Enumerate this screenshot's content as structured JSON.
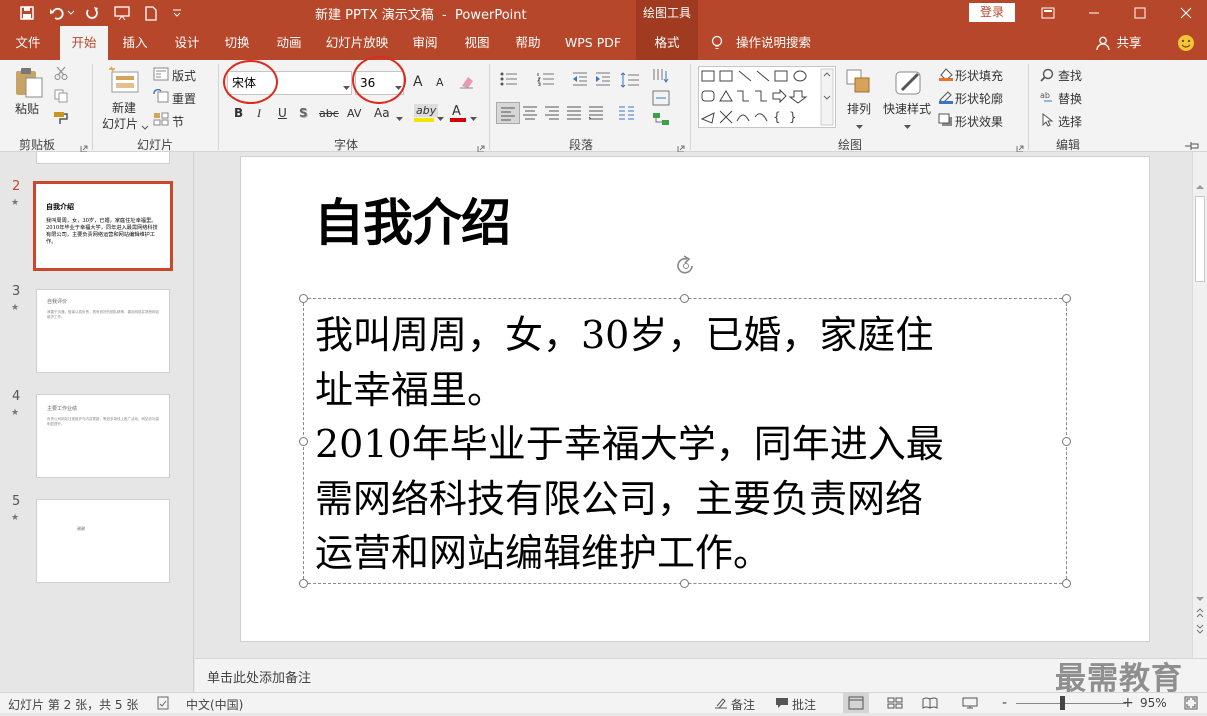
{
  "app": {
    "window_title": "新建 PPTX 演示文稿  -  PowerPoint",
    "context_tools": "绘图工具",
    "login": "登录"
  },
  "tabs": [
    "文件",
    "开始",
    "插入",
    "设计",
    "切换",
    "动画",
    "幻灯片放映",
    "审阅",
    "视图",
    "帮助",
    "WPS PDF",
    "格式"
  ],
  "tell_me": "操作说明搜索",
  "share": "共享",
  "ribbon": {
    "clipboard": {
      "paste": "粘贴",
      "label": "剪贴板"
    },
    "slides": {
      "new_slide_1": "新建",
      "new_slide_2": "幻灯片",
      "layout": "版式",
      "reset": "重置",
      "section": "节",
      "label": "幻灯片"
    },
    "font": {
      "name": "宋体",
      "size": "36",
      "grow": "A",
      "shrink": "A",
      "bold": "B",
      "italic": "I",
      "underline": "U",
      "shadow": "S",
      "strike": "abc",
      "spacing": "AV",
      "case": "Aa",
      "highlight": "aby",
      "color": "A",
      "label": "字体"
    },
    "paragraph": {
      "label": "段落"
    },
    "drawing": {
      "arrange": "排列",
      "quick_styles": "快速样式",
      "fill": "形状填充",
      "outline": "形状轮廓",
      "effects": "形状效果",
      "label": "绘图"
    },
    "editing": {
      "find": "查找",
      "replace": "替换",
      "select": "选择",
      "label": "编辑"
    }
  },
  "thumbnails": [
    {
      "num": "2",
      "star": "★",
      "title": "自我介绍",
      "body": "我叫周周，女，30岁，已婚，家庭住址幸福里。2010年毕业于幸福大学，同年进入最需网络科技有限公司，主要负责网络运营和网站编辑维护工作。"
    },
    {
      "num": "3",
      "star": "★",
      "title": "自我评价",
      "body": "我善于沟通，做事认真负责，具有良好的团队精神，喜欢网络并熟悉网站维护工作。"
    },
    {
      "num": "4",
      "star": "★",
      "title": "主要工作业绩",
      "body": "负责公司网站日常维护与内容更新，策划多场线上推广活动，网站访问量明显提升。"
    },
    {
      "num": "5",
      "star": "★",
      "title": "",
      "body": "谢谢"
    }
  ],
  "slide": {
    "title": "自我介绍",
    "lines": [
      "我叫周周，女，30岁，已婚，家庭住",
      "址幸福里。",
      "2010年毕业于幸福大学，同年进入最",
      "需网络科技有限公司，主要负责网络",
      "运营和网站编辑维护工作。"
    ]
  },
  "notes_placeholder": "单击此处添加备注",
  "watermark": "最需教育",
  "status": {
    "slide_info": "幻灯片 第 2 张，共 5 张",
    "language": "中文(中国)",
    "notes": "备注",
    "comments": "批注",
    "zoom": "95%",
    "minus": "-",
    "plus": "+"
  },
  "colors": {
    "accent": "#b7472a",
    "ribbon": "#f3f3f3",
    "highlight_circle": "#e0281c"
  }
}
